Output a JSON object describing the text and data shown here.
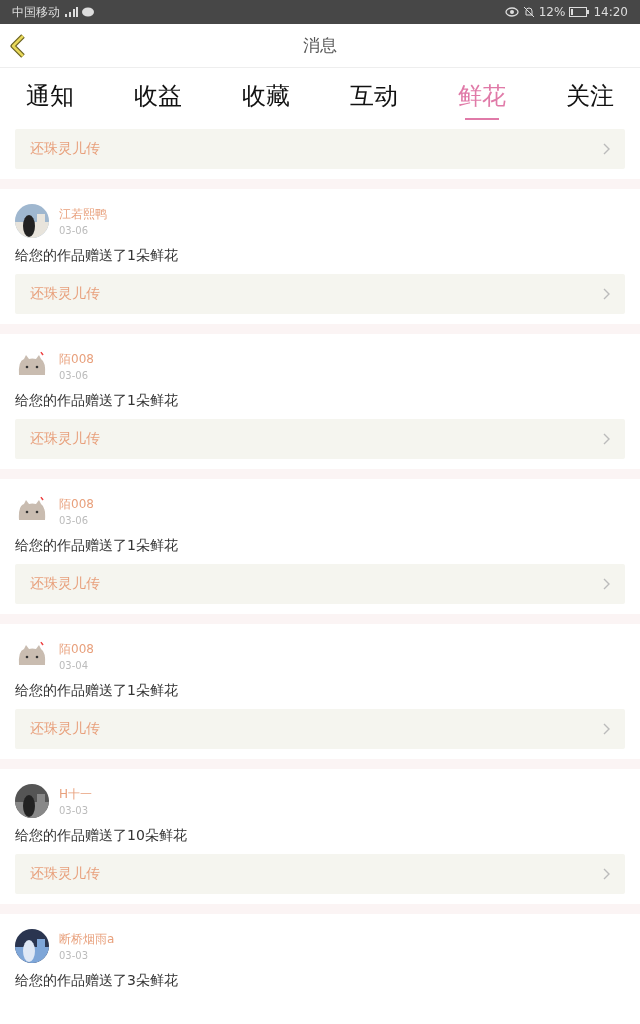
{
  "status_bar": {
    "carrier": "中国移动",
    "battery": "12%",
    "time": "14:20"
  },
  "header": {
    "title": "消息"
  },
  "tabs": [
    {
      "label": "通知",
      "selected": false
    },
    {
      "label": "收益",
      "selected": false
    },
    {
      "label": "收藏",
      "selected": false
    },
    {
      "label": "互动",
      "selected": false
    },
    {
      "label": "鲜花",
      "selected": true
    },
    {
      "label": "关注",
      "selected": false
    }
  ],
  "partial_item": {
    "link": "还珠灵儿传"
  },
  "items": [
    {
      "name": "江若熙鸭",
      "date": "03-06",
      "message": "给您的作品赠送了1朵鲜花",
      "link": "还珠灵儿传"
    },
    {
      "kind": "cat",
      "name": "陌008",
      "date": "03-06",
      "message": "给您的作品赠送了1朵鲜花",
      "link": "还珠灵儿传"
    },
    {
      "kind": "cat",
      "name": "陌008",
      "date": "03-06",
      "message": "给您的作品赠送了1朵鲜花",
      "link": "还珠灵儿传"
    },
    {
      "kind": "cat",
      "name": "陌008",
      "date": "03-04",
      "message": "给您的作品赠送了1朵鲜花",
      "link": "还珠灵儿传"
    },
    {
      "name": "H十一",
      "date": "03-03",
      "message": "给您的作品赠送了10朵鲜花",
      "link": "还珠灵儿传"
    },
    {
      "name": "断桥烟雨a",
      "date": "03-03",
      "message": "给您的作品赠送了3朵鲜花"
    }
  ]
}
